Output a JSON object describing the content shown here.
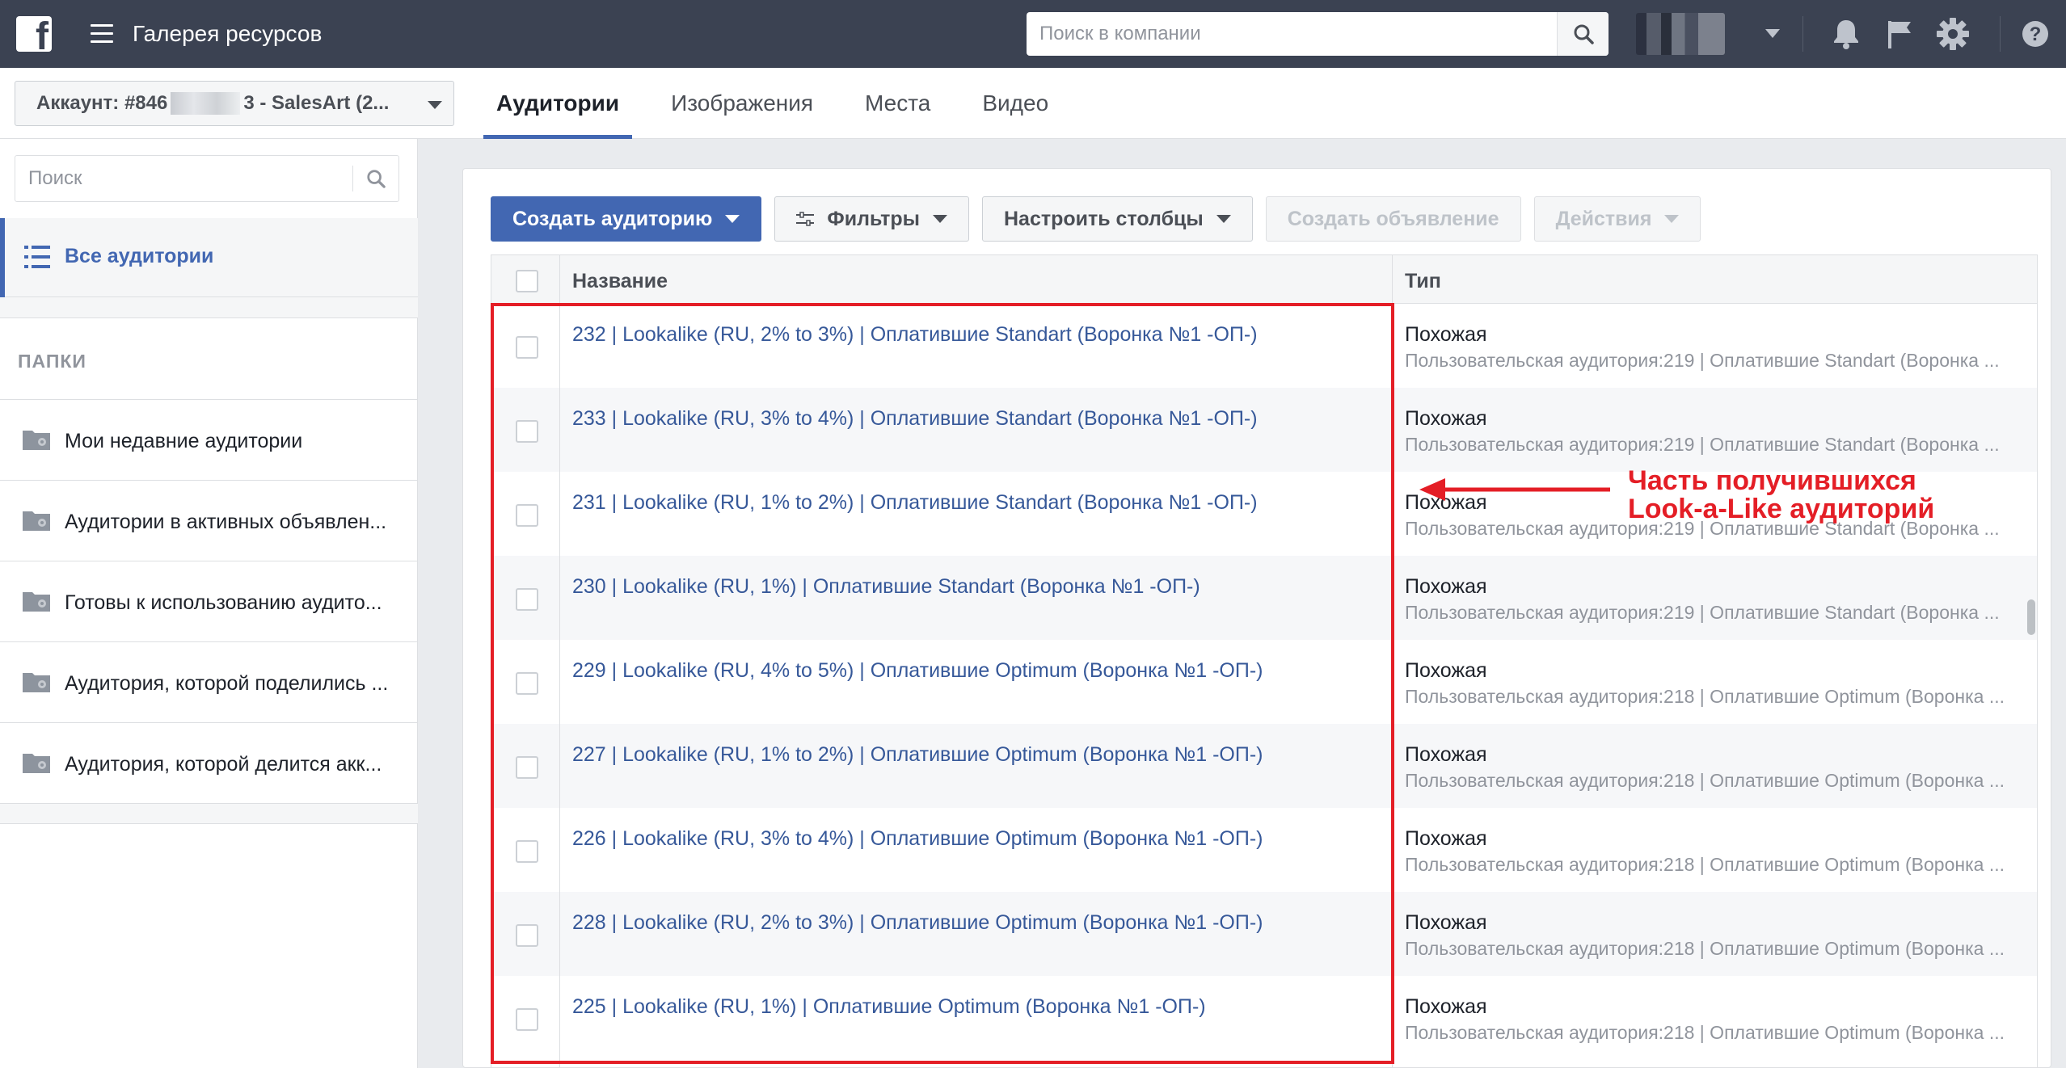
{
  "app": {
    "title": "Галерея ресурсов",
    "search_placeholder": "Поиск в компании"
  },
  "account": {
    "prefix": "Аккаунт: #846",
    "suffix": "3 - SalesArt (2..."
  },
  "tabs": [
    {
      "label": "Аудитории",
      "active": true
    },
    {
      "label": "Изображения",
      "active": false
    },
    {
      "label": "Места",
      "active": false
    },
    {
      "label": "Видео",
      "active": false
    }
  ],
  "sidebar": {
    "search_placeholder": "Поиск",
    "all_audiences": "Все аудитории",
    "folders_heading": "ПАПКИ",
    "folders": [
      {
        "label": "Мои недавние аудитории"
      },
      {
        "label": "Аудитории в активных объявлен..."
      },
      {
        "label": "Готовы к использованию аудито..."
      },
      {
        "label": "Аудитория, которой поделились ..."
      },
      {
        "label": "Аудитория, которой делится акк..."
      }
    ]
  },
  "toolbar": {
    "create_audience": "Создать аудиторию",
    "filters": "Фильтры",
    "columns": "Настроить столбцы",
    "create_ad": "Создать объявление",
    "actions": "Действия"
  },
  "table": {
    "headers": {
      "name": "Название",
      "type": "Тип"
    },
    "rows": [
      {
        "name": "232 | Lookalike (RU, 2% to 3%) | Оплатившие Standart (Воронка №1 -ОП-)",
        "type": "Похожая",
        "source": "Пользовательская аудитория:219 | Оплатившие Standart (Воронка ..."
      },
      {
        "name": "233 | Lookalike (RU, 3% to 4%) | Оплатившие Standart (Воронка №1 -ОП-)",
        "type": "Похожая",
        "source": "Пользовательская аудитория:219 | Оплатившие Standart (Воронка ..."
      },
      {
        "name": "231 | Lookalike (RU, 1% to 2%) | Оплатившие Standart (Воронка №1 -ОП-)",
        "type": "Похожая",
        "source": "Пользовательская аудитория:219 | Оплатившие Standart (Воронка ..."
      },
      {
        "name": "230 | Lookalike (RU, 1%) | Оплатившие Standart (Воронка №1 -ОП-)",
        "type": "Похожая",
        "source": "Пользовательская аудитория:219 | Оплатившие Standart (Воронка ..."
      },
      {
        "name": "229 | Lookalike (RU, 4% to 5%) | Оплатившие Optimum (Воронка №1 -ОП-)",
        "type": "Похожая",
        "source": "Пользовательская аудитория:218 | Оплатившие Optimum (Воронка ..."
      },
      {
        "name": "227 | Lookalike (RU, 1% to 2%) | Оплатившие Optimum (Воронка №1 -ОП-)",
        "type": "Похожая",
        "source": "Пользовательская аудитория:218 | Оплатившие Optimum (Воронка ..."
      },
      {
        "name": "226 | Lookalike (RU, 3% to 4%) | Оплатившие Optimum (Воронка №1 -ОП-)",
        "type": "Похожая",
        "source": "Пользовательская аудитория:218 | Оплатившие Optimum (Воронка ..."
      },
      {
        "name": "228 | Lookalike (RU, 2% to 3%) | Оплатившие Optimum (Воронка №1 -ОП-)",
        "type": "Похожая",
        "source": "Пользовательская аудитория:218 | Оплатившие Optimum (Воронка ..."
      },
      {
        "name": "225 | Lookalike (RU, 1%) | Оплатившие Optimum (Воронка №1 -ОП-)",
        "type": "Похожая",
        "source": "Пользовательская аудитория:218 | Оплатившие Optimum (Воронка ..."
      }
    ]
  },
  "annotation": {
    "line1": "Часть получившихся",
    "line2": "Look-a-Like аудиторий",
    "color": "#e41e26"
  },
  "icons": {
    "logo": "facebook-logo-icon",
    "menu": "hamburger-menu-icon",
    "search": "search-icon",
    "notifications": "bell-icon",
    "flag": "flag-icon",
    "settings": "gear-icon",
    "help": "help-icon",
    "folder": "folder-gear-icon",
    "list": "list-icon"
  },
  "colors": {
    "topbar": "#3b4252",
    "accent": "#4267b2",
    "link": "#365899"
  }
}
